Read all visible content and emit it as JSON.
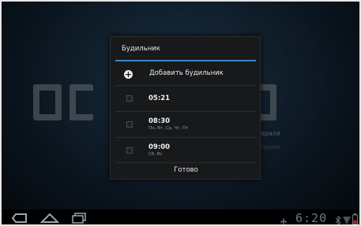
{
  "dialog": {
    "title": "Будильник",
    "add_label": "Добавить будильник",
    "alarms": [
      {
        "time": "05:21",
        "days": ""
      },
      {
        "time": "08:30",
        "days": "Пн, Вт, Ср, Чт, Пт"
      },
      {
        "time": "09:00",
        "days": "Сб, Вс"
      }
    ],
    "done_label": "Готово"
  },
  "background": {
    "date_fragment": "враля",
    "side_fragment": "льник"
  },
  "status": {
    "time": "6:20"
  }
}
